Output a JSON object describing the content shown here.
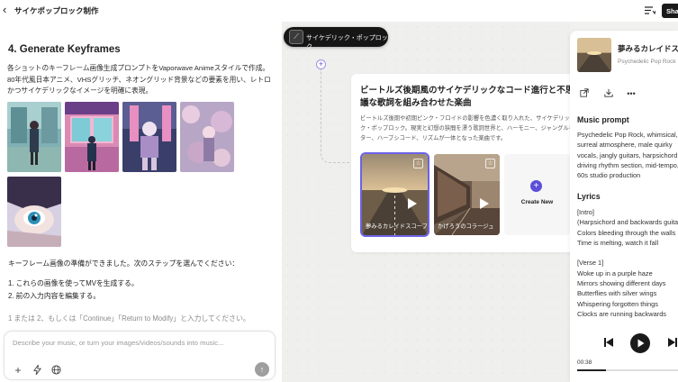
{
  "header": {
    "back_label": "‹",
    "title": "サイケポップロック制作",
    "share_label": "Shar"
  },
  "chat": {
    "section_title": "4. Generate Keyframes",
    "section_desc": "各ショットのキーフレーム画像生成プロンプトをVaporwave Animeスタイルで作成。80年代風日本アニメ、VHSグリッチ、ネオングリッド背景などの要素を用い、レトロかつサイケデリックなイメージを明確に表現。",
    "keyframes": [
      "keyframe-1",
      "keyframe-2",
      "keyframe-3",
      "keyframe-4",
      "keyframe-5"
    ],
    "status": "キーフレーム画像の準備ができました。次のステップを選んでください：",
    "option_1": "1. これらの画像を使ってMVを生成する。",
    "option_2": "2. 前の入力内容を編集する。",
    "hint": "1 または 2、もしくは「Continue」「Return to Modify」と入力してください。",
    "composer_placeholder": "Describe your music, or turn your images/videos/sounds into music..."
  },
  "canvas": {
    "style_pill": "サイケデリック・ポップロック",
    "card_title": "ビートルズ後期風のサイケデリックなコード進行と不思議な歌詞を組み合わせた楽曲",
    "card_desc": "ビートルズ後期や初期ピンク・フロイドの影響を色濃く取り入れた、サイケデリック・ポップロック。現実と幻想の狭間を漂う歌詞世界と、ハーモニー、ジャングルギター、ハープシコード、リズムが一体となった楽曲です。",
    "songs": [
      {
        "label": "夢みるカレイドスコープ",
        "selected": true
      },
      {
        "label": "かげろうのコラージュ",
        "selected": false
      }
    ],
    "create_new": "Create New"
  },
  "detail": {
    "title": "夢みるカレイドスコ",
    "genre": "Psychedelic Pop Rock",
    "music_prompt_heading": "Music prompt",
    "music_prompt_lines": [
      "Psychedelic Pop Rock, whimsical,",
      "surreal atmosphere, male quirky",
      "vocals, jangly guitars, harpsichord,",
      "driving rhythm section, mid-tempo,",
      "60s studio production"
    ],
    "lyrics_heading": "Lyrics",
    "lyrics_lines": [
      "[Intro]",
      "(Harpsichord and backwards guitar)",
      "Colors bleeding through the walls",
      "Time is melting, watch it fall",
      "",
      "[Verse 1]",
      "Woke up in a purple haze",
      "Mirrors showing different days",
      "Butterflies with silver wings",
      "Whispering forgotten things",
      "Clocks are running backwards"
    ],
    "time": "00:38",
    "progress": 0.28
  },
  "colors": {
    "accent": "#5b4fd8",
    "dark": "#161616"
  }
}
